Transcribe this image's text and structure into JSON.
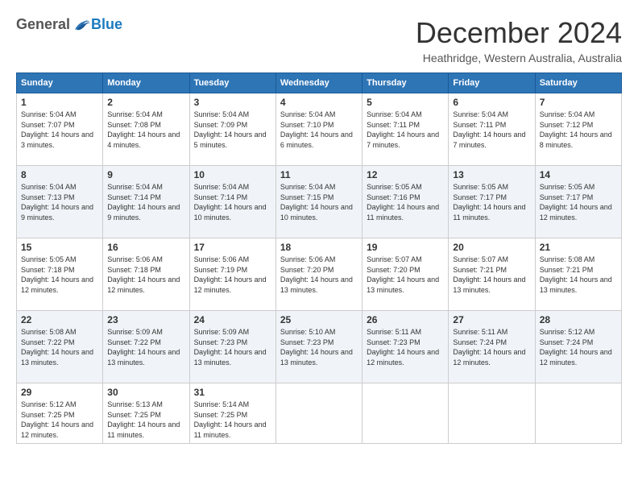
{
  "header": {
    "logo_general": "General",
    "logo_blue": "Blue",
    "month_title": "December 2024",
    "subtitle": "Heathridge, Western Australia, Australia"
  },
  "calendar": {
    "days_of_week": [
      "Sunday",
      "Monday",
      "Tuesday",
      "Wednesday",
      "Thursday",
      "Friday",
      "Saturday"
    ],
    "weeks": [
      [
        {
          "day": "1",
          "sunrise": "Sunrise: 5:04 AM",
          "sunset": "Sunset: 7:07 PM",
          "daylight": "Daylight: 14 hours and 3 minutes."
        },
        {
          "day": "2",
          "sunrise": "Sunrise: 5:04 AM",
          "sunset": "Sunset: 7:08 PM",
          "daylight": "Daylight: 14 hours and 4 minutes."
        },
        {
          "day": "3",
          "sunrise": "Sunrise: 5:04 AM",
          "sunset": "Sunset: 7:09 PM",
          "daylight": "Daylight: 14 hours and 5 minutes."
        },
        {
          "day": "4",
          "sunrise": "Sunrise: 5:04 AM",
          "sunset": "Sunset: 7:10 PM",
          "daylight": "Daylight: 14 hours and 6 minutes."
        },
        {
          "day": "5",
          "sunrise": "Sunrise: 5:04 AM",
          "sunset": "Sunset: 7:11 PM",
          "daylight": "Daylight: 14 hours and 7 minutes."
        },
        {
          "day": "6",
          "sunrise": "Sunrise: 5:04 AM",
          "sunset": "Sunset: 7:11 PM",
          "daylight": "Daylight: 14 hours and 7 minutes."
        },
        {
          "day": "7",
          "sunrise": "Sunrise: 5:04 AM",
          "sunset": "Sunset: 7:12 PM",
          "daylight": "Daylight: 14 hours and 8 minutes."
        }
      ],
      [
        {
          "day": "8",
          "sunrise": "Sunrise: 5:04 AM",
          "sunset": "Sunset: 7:13 PM",
          "daylight": "Daylight: 14 hours and 9 minutes."
        },
        {
          "day": "9",
          "sunrise": "Sunrise: 5:04 AM",
          "sunset": "Sunset: 7:14 PM",
          "daylight": "Daylight: 14 hours and 9 minutes."
        },
        {
          "day": "10",
          "sunrise": "Sunrise: 5:04 AM",
          "sunset": "Sunset: 7:14 PM",
          "daylight": "Daylight: 14 hours and 10 minutes."
        },
        {
          "day": "11",
          "sunrise": "Sunrise: 5:04 AM",
          "sunset": "Sunset: 7:15 PM",
          "daylight": "Daylight: 14 hours and 10 minutes."
        },
        {
          "day": "12",
          "sunrise": "Sunrise: 5:05 AM",
          "sunset": "Sunset: 7:16 PM",
          "daylight": "Daylight: 14 hours and 11 minutes."
        },
        {
          "day": "13",
          "sunrise": "Sunrise: 5:05 AM",
          "sunset": "Sunset: 7:17 PM",
          "daylight": "Daylight: 14 hours and 11 minutes."
        },
        {
          "day": "14",
          "sunrise": "Sunrise: 5:05 AM",
          "sunset": "Sunset: 7:17 PM",
          "daylight": "Daylight: 14 hours and 12 minutes."
        }
      ],
      [
        {
          "day": "15",
          "sunrise": "Sunrise: 5:05 AM",
          "sunset": "Sunset: 7:18 PM",
          "daylight": "Daylight: 14 hours and 12 minutes."
        },
        {
          "day": "16",
          "sunrise": "Sunrise: 5:06 AM",
          "sunset": "Sunset: 7:18 PM",
          "daylight": "Daylight: 14 hours and 12 minutes."
        },
        {
          "day": "17",
          "sunrise": "Sunrise: 5:06 AM",
          "sunset": "Sunset: 7:19 PM",
          "daylight": "Daylight: 14 hours and 12 minutes."
        },
        {
          "day": "18",
          "sunrise": "Sunrise: 5:06 AM",
          "sunset": "Sunset: 7:20 PM",
          "daylight": "Daylight: 14 hours and 13 minutes."
        },
        {
          "day": "19",
          "sunrise": "Sunrise: 5:07 AM",
          "sunset": "Sunset: 7:20 PM",
          "daylight": "Daylight: 14 hours and 13 minutes."
        },
        {
          "day": "20",
          "sunrise": "Sunrise: 5:07 AM",
          "sunset": "Sunset: 7:21 PM",
          "daylight": "Daylight: 14 hours and 13 minutes."
        },
        {
          "day": "21",
          "sunrise": "Sunrise: 5:08 AM",
          "sunset": "Sunset: 7:21 PM",
          "daylight": "Daylight: 14 hours and 13 minutes."
        }
      ],
      [
        {
          "day": "22",
          "sunrise": "Sunrise: 5:08 AM",
          "sunset": "Sunset: 7:22 PM",
          "daylight": "Daylight: 14 hours and 13 minutes."
        },
        {
          "day": "23",
          "sunrise": "Sunrise: 5:09 AM",
          "sunset": "Sunset: 7:22 PM",
          "daylight": "Daylight: 14 hours and 13 minutes."
        },
        {
          "day": "24",
          "sunrise": "Sunrise: 5:09 AM",
          "sunset": "Sunset: 7:23 PM",
          "daylight": "Daylight: 14 hours and 13 minutes."
        },
        {
          "day": "25",
          "sunrise": "Sunrise: 5:10 AM",
          "sunset": "Sunset: 7:23 PM",
          "daylight": "Daylight: 14 hours and 13 minutes."
        },
        {
          "day": "26",
          "sunrise": "Sunrise: 5:11 AM",
          "sunset": "Sunset: 7:23 PM",
          "daylight": "Daylight: 14 hours and 12 minutes."
        },
        {
          "day": "27",
          "sunrise": "Sunrise: 5:11 AM",
          "sunset": "Sunset: 7:24 PM",
          "daylight": "Daylight: 14 hours and 12 minutes."
        },
        {
          "day": "28",
          "sunrise": "Sunrise: 5:12 AM",
          "sunset": "Sunset: 7:24 PM",
          "daylight": "Daylight: 14 hours and 12 minutes."
        }
      ],
      [
        {
          "day": "29",
          "sunrise": "Sunrise: 5:12 AM",
          "sunset": "Sunset: 7:25 PM",
          "daylight": "Daylight: 14 hours and 12 minutes."
        },
        {
          "day": "30",
          "sunrise": "Sunrise: 5:13 AM",
          "sunset": "Sunset: 7:25 PM",
          "daylight": "Daylight: 14 hours and 11 minutes."
        },
        {
          "day": "31",
          "sunrise": "Sunrise: 5:14 AM",
          "sunset": "Sunset: 7:25 PM",
          "daylight": "Daylight: 14 hours and 11 minutes."
        },
        null,
        null,
        null,
        null
      ]
    ]
  }
}
